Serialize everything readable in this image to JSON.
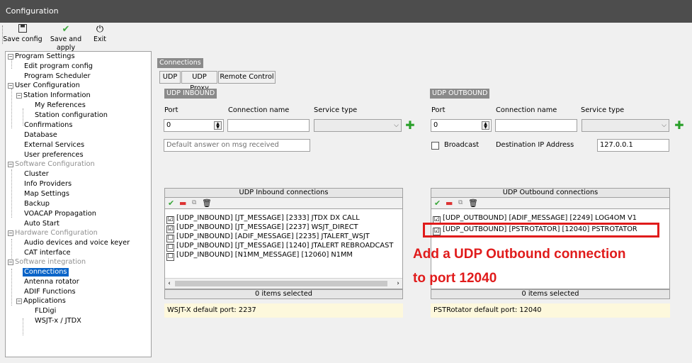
{
  "window": {
    "title": "Configuration"
  },
  "toolbar": {
    "save_config": "Save config",
    "save_apply": "Save and apply",
    "exit": "Exit"
  },
  "tree": {
    "program_settings": "Program Settings",
    "edit_program_config": "Edit program config",
    "program_scheduler": "Program Scheduler",
    "user_configuration": "User Configuration",
    "station_information": "Station Information",
    "my_references": "My References",
    "station_configuration": "Station configuration",
    "confirmations": "Confirmations",
    "database": "Database",
    "external_services": "External Services",
    "user_preferences": "User preferences",
    "software_configuration": "Software Configuration",
    "cluster": "Cluster",
    "info_providers": "Info Providers",
    "map_settings": "Map Settings",
    "backup": "Backup",
    "voacap_propagation": "VOACAP Propagation",
    "auto_start": "Auto Start",
    "hardware_configuration": "Hardware Configuration",
    "audio_devices": "Audio devices and voice keyer",
    "cat_interface": "CAT interface",
    "software_integration": "Software integration",
    "connections": "Connections",
    "antenna_rotator": "Antenna rotator",
    "adif_functions": "ADIF Functions",
    "applications": "Applications",
    "fldigi": "FLDigi",
    "wsjtx_jtdx": "WSJT-x / JTDX"
  },
  "panel": {
    "title": "Connections",
    "tabs": [
      "UDP",
      "UDP Proxy",
      "Remote Control"
    ]
  },
  "inbound": {
    "section_title": "UDP INBOUND",
    "port_label": "Port",
    "name_label": "Connection name",
    "service_label": "Service type",
    "port_value": "0",
    "default_answer_placeholder": "Default answer on msg received",
    "list_title": "UDP Inbound connections",
    "items": [
      {
        "checked": "☑",
        "text": "[UDP_INBOUND] [JT_MESSAGE] [2333] JTDX DX CALL"
      },
      {
        "checked": "☑",
        "text": "[UDP_INBOUND] [JT_MESSAGE] [2237] WSJT_DIRECT"
      },
      {
        "checked": "☐",
        "text": "[UDP_INBOUND] [ADIF_MESSAGE] [2235] JTALERT_WSJT"
      },
      {
        "checked": "☐",
        "text": "[UDP_INBOUND] [JT_MESSAGE] [1240] JTALERT REBROADCAST"
      },
      {
        "checked": "☐",
        "text": "[UDP_INBOUND] [N1MM_MESSAGE] [12060] N1MM"
      }
    ],
    "status": "0 items selected",
    "note": "WSJT-X default port: 2237"
  },
  "outbound": {
    "section_title": "UDP OUTBOUND",
    "port_label": "Port",
    "name_label": "Connection name",
    "service_label": "Service type",
    "port_value": "0",
    "broadcast_label": "Broadcast",
    "dest_ip_label": "Destination IP Address",
    "dest_ip_value": "127.0.0.1",
    "list_title": "UDP Outbound connections",
    "items": [
      {
        "checked": "☑",
        "text": "[UDP_OUTBOUND] [ADIF_MESSAGE] [2249] LOG4OM V1"
      },
      {
        "checked": "☑",
        "text": "[UDP_OUTBOUND] [PSTROTATOR] [12040] PSTROTATOR"
      }
    ],
    "status": "0 items selected",
    "note": "PSTRotator default port: 12040"
  },
  "annotation": {
    "line1": "Add a UDP Outbound connection",
    "line2": "to port 12040"
  },
  "icons": {
    "save": "floppy-icon",
    "apply": "check-icon",
    "exit": "power-icon",
    "add": "plus-icon",
    "remove": "minus-icon",
    "copy": "copy-icon",
    "delete": "trash-icon"
  },
  "colors": {
    "titlebar": "#4d4d4d",
    "selection": "#0a64c8",
    "annotation": "#e01b1b",
    "note_bg": "#fdf8dc",
    "add_green": "#2aa02a"
  }
}
